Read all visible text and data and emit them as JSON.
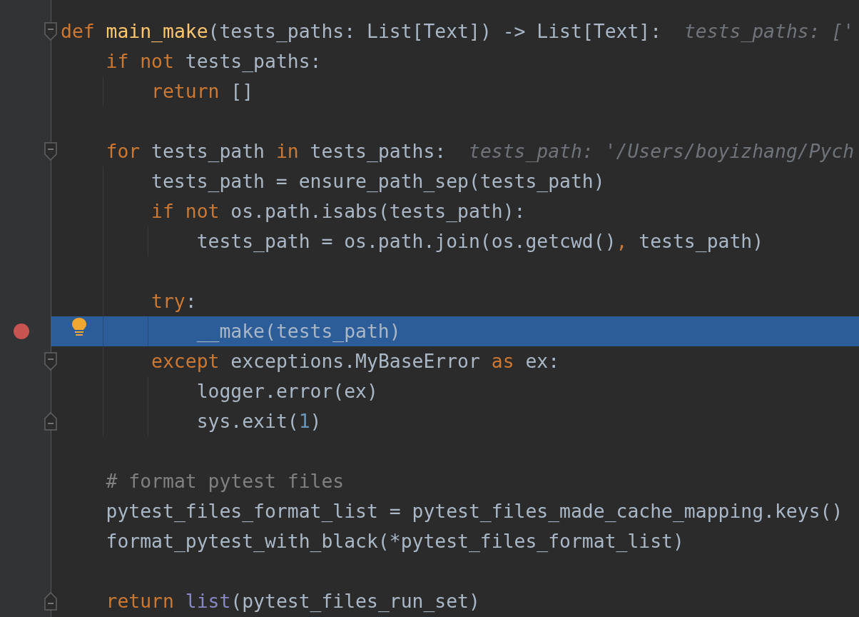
{
  "editor": {
    "lines": [
      {
        "kind": "code",
        "fold_start": true,
        "fold_end": false,
        "breakpoint": false,
        "selected": false,
        "intention": false,
        "tokens": [
          {
            "kind": "kw",
            "text": "def "
          },
          {
            "kind": "fn",
            "text": "main_make"
          },
          {
            "kind": "p",
            "text": "(tests_paths: List[Text]) -> List[Text]:  "
          },
          {
            "kind": "hint",
            "text": "tests_paths: ['"
          }
        ],
        "children": [
          {
            "kind": "code",
            "fold_start": false,
            "fold_end": false,
            "breakpoint": false,
            "selected": false,
            "intention": false,
            "tokens": [
              {
                "kind": "kw",
                "text": "if not"
              },
              {
                "kind": "p",
                "text": " tests_paths:"
              }
            ],
            "children": [
              {
                "kind": "code",
                "fold_start": false,
                "fold_end": false,
                "breakpoint": false,
                "selected": false,
                "intention": false,
                "tokens": [
                  {
                    "kind": "kw",
                    "text": "return"
                  },
                  {
                    "kind": "p",
                    "text": " []"
                  }
                ]
              }
            ]
          },
          {
            "kind": "blank"
          },
          {
            "kind": "code",
            "fold_start": true,
            "fold_end": false,
            "breakpoint": false,
            "selected": false,
            "intention": false,
            "tokens": [
              {
                "kind": "kw",
                "text": "for"
              },
              {
                "kind": "p",
                "text": " tests_path "
              },
              {
                "kind": "kw",
                "text": "in"
              },
              {
                "kind": "p",
                "text": " tests_paths:  "
              },
              {
                "kind": "hint",
                "text": "tests_path: '/Users/boyizhang/Pych"
              }
            ],
            "children": [
              {
                "kind": "code",
                "fold_start": false,
                "fold_end": false,
                "breakpoint": false,
                "selected": false,
                "intention": false,
                "tokens": [
                  {
                    "kind": "p",
                    "text": "tests_path = ensure_path_sep(tests_path)"
                  }
                ]
              },
              {
                "kind": "code",
                "fold_start": false,
                "fold_end": false,
                "breakpoint": false,
                "selected": false,
                "intention": false,
                "tokens": [
                  {
                    "kind": "kw",
                    "text": "if not"
                  },
                  {
                    "kind": "p",
                    "text": " os.path.isabs(tests_path):"
                  }
                ],
                "children": [
                  {
                    "kind": "code",
                    "fold_start": false,
                    "fold_end": false,
                    "breakpoint": false,
                    "selected": false,
                    "intention": false,
                    "tokens": [
                      {
                        "kind": "p",
                        "text": "tests_path = os.path.join(os.getcwd()"
                      },
                      {
                        "kind": "kw",
                        "text": ","
                      },
                      {
                        "kind": "p",
                        "text": " tests_path)"
                      }
                    ]
                  }
                ]
              },
              {
                "kind": "blank"
              },
              {
                "kind": "code",
                "fold_start": false,
                "fold_end": false,
                "breakpoint": false,
                "selected": false,
                "intention": false,
                "tokens": [
                  {
                    "kind": "kw",
                    "text": "try"
                  },
                  {
                    "kind": "p",
                    "text": ":"
                  }
                ],
                "children": [
                  {
                    "kind": "code",
                    "fold_start": false,
                    "fold_end": false,
                    "breakpoint": true,
                    "selected": true,
                    "intention": true,
                    "tokens": [
                      {
                        "kind": "p",
                        "text": "__make(tests_path)"
                      }
                    ]
                  }
                ]
              },
              {
                "kind": "code",
                "fold_start": true,
                "fold_end": false,
                "breakpoint": false,
                "selected": false,
                "intention": false,
                "tokens": [
                  {
                    "kind": "kw",
                    "text": "except"
                  },
                  {
                    "kind": "p",
                    "text": " exceptions.MyBaseError "
                  },
                  {
                    "kind": "kw",
                    "text": "as"
                  },
                  {
                    "kind": "p",
                    "text": " ex:"
                  }
                ],
                "children": [
                  {
                    "kind": "code",
                    "fold_start": false,
                    "fold_end": false,
                    "breakpoint": false,
                    "selected": false,
                    "intention": false,
                    "tokens": [
                      {
                        "kind": "p",
                        "text": "logger.error(ex)"
                      }
                    ]
                  },
                  {
                    "kind": "code",
                    "fold_start": false,
                    "fold_end": true,
                    "breakpoint": false,
                    "selected": false,
                    "intention": false,
                    "tokens": [
                      {
                        "kind": "p",
                        "text": "sys.exit("
                      },
                      {
                        "kind": "num",
                        "text": "1"
                      },
                      {
                        "kind": "p",
                        "text": ")"
                      }
                    ]
                  }
                ]
              }
            ]
          },
          {
            "kind": "blank"
          },
          {
            "kind": "code",
            "fold_start": false,
            "fold_end": false,
            "breakpoint": false,
            "selected": false,
            "intention": false,
            "tokens": [
              {
                "kind": "comment",
                "text": "# format pytest files"
              }
            ]
          },
          {
            "kind": "code",
            "fold_start": false,
            "fold_end": false,
            "breakpoint": false,
            "selected": false,
            "intention": false,
            "tokens": [
              {
                "kind": "p",
                "text": "pytest_files_format_list = pytest_files_made_cache_mapping.keys()"
              }
            ]
          },
          {
            "kind": "code",
            "fold_start": false,
            "fold_end": false,
            "breakpoint": false,
            "selected": false,
            "intention": false,
            "tokens": [
              {
                "kind": "p",
                "text": "format_pytest_with_black(*pytest_files_format_list)"
              }
            ]
          },
          {
            "kind": "blank"
          },
          {
            "kind": "code",
            "fold_start": false,
            "fold_end": true,
            "breakpoint": false,
            "selected": false,
            "intention": false,
            "tokens": [
              {
                "kind": "kw",
                "text": "return "
              },
              {
                "kind": "builtin",
                "text": "list"
              },
              {
                "kind": "p",
                "text": "(pytest_files_run_set)"
              }
            ]
          }
        ]
      }
    ]
  }
}
